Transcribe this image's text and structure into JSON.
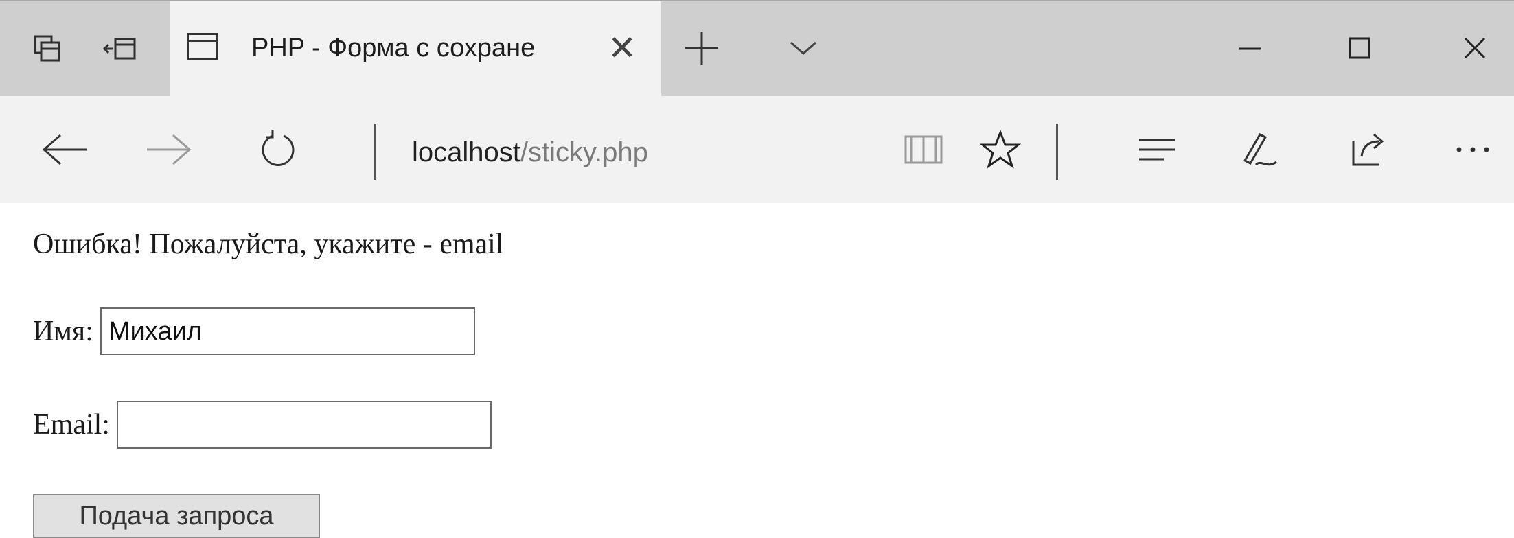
{
  "browser": {
    "tab": {
      "title": "PHP - Форма с сохране"
    },
    "address_bar": {
      "host": "localhost",
      "path": "/sticky.php"
    }
  },
  "page": {
    "error_message": "Ошибка! Пожалуйста, укажите - email",
    "name_field": {
      "label": "Имя:",
      "value": "Михаил"
    },
    "email_field": {
      "label": "Email:",
      "value": ""
    },
    "submit_label": "Подача запроса"
  },
  "icons": {
    "tabs_aside": "tabs-aside-icon",
    "tab_preview": "tab-preview-icon",
    "page": "page-icon",
    "close_tab": "close-icon",
    "new_tab": "plus-icon",
    "tab_list": "chevron-down-icon",
    "minimize": "minimize-icon",
    "maximize": "maximize-icon",
    "close_window": "close-icon",
    "back": "arrow-left-icon",
    "forward": "arrow-right-icon",
    "refresh": "refresh-icon",
    "reading_view": "book-icon",
    "favorite": "star-icon",
    "hub": "hub-icon",
    "web_note": "pen-icon",
    "share": "share-icon",
    "more": "more-icon"
  },
  "colors": {
    "tab_strip": "#cfcfcf",
    "toolbar": "#f2f2f2",
    "page_bg": "#ffffff"
  }
}
